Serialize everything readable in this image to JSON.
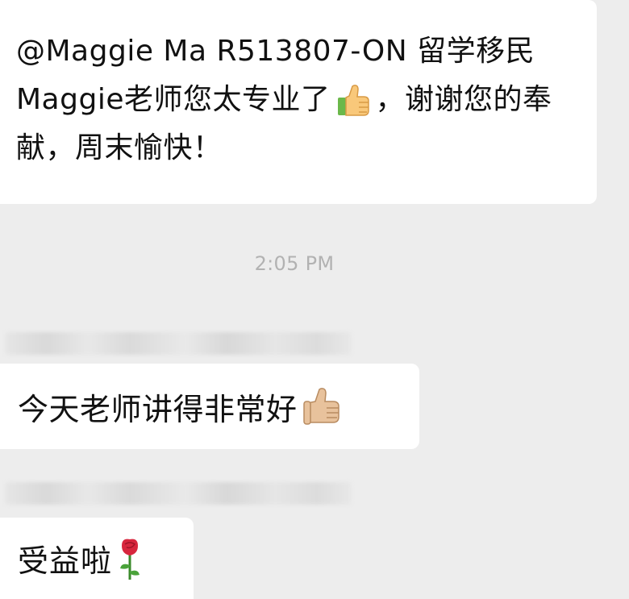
{
  "messages": [
    {
      "text": "@Maggie Ma R513807-ON 留学移民 Maggie老师您太专业了",
      "emoji": "thumbs-up-icon",
      "text_after": "，谢谢您的奉献，周末愉快！"
    },
    {
      "text": "今天老师讲得非常好",
      "emoji": "thumbs-up-icon"
    },
    {
      "text": "受益啦",
      "emoji": "rose-icon"
    }
  ],
  "timestamp": "2:05 PM",
  "colors": {
    "background": "#ededed",
    "bubble": "#ffffff",
    "text": "#111111",
    "timestamp": "#b2b2b2"
  }
}
